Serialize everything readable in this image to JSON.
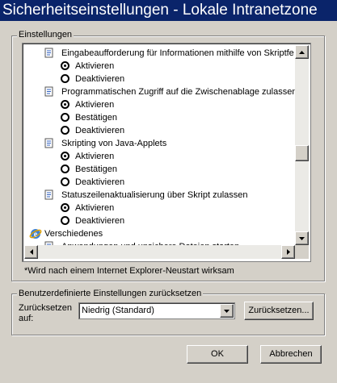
{
  "window": {
    "title": "Sicherheitseinstellungen - Lokale Intranetzone"
  },
  "settings_group": {
    "label": "Einstellungen"
  },
  "settings_list": [
    {
      "type": "setting",
      "label": "Eingabeaufforderung für Informationen mithilfe von Skriptfe"
    },
    {
      "type": "option",
      "label": "Aktivieren",
      "checked": true
    },
    {
      "type": "option",
      "label": "Deaktivieren",
      "checked": false
    },
    {
      "type": "setting",
      "label": "Programmatischen Zugriff auf die Zwischenablage zulassen"
    },
    {
      "type": "option",
      "label": "Aktivieren",
      "checked": true
    },
    {
      "type": "option",
      "label": "Bestätigen",
      "checked": false
    },
    {
      "type": "option",
      "label": "Deaktivieren",
      "checked": false
    },
    {
      "type": "setting",
      "label": "Skripting von Java-Applets"
    },
    {
      "type": "option",
      "label": "Aktivieren",
      "checked": true
    },
    {
      "type": "option",
      "label": "Bestätigen",
      "checked": false
    },
    {
      "type": "option",
      "label": "Deaktivieren",
      "checked": false
    },
    {
      "type": "setting",
      "label": "Statuszeilenaktualisierung über Skript zulassen"
    },
    {
      "type": "option",
      "label": "Aktivieren",
      "checked": true
    },
    {
      "type": "option",
      "label": "Deaktivieren",
      "checked": false
    },
    {
      "type": "category",
      "label": "Verschiedenes"
    },
    {
      "type": "setting",
      "label": "Anwendungen und unsichere Dateien starten"
    }
  ],
  "restart_note": "*Wird nach einem Internet Explorer-Neustart wirksam",
  "reset_group": {
    "label": "Benutzerdefinierte Einstellungen zurücksetzen",
    "reset_to_label_1": "Zurücksetzen",
    "reset_to_label_2": "auf:",
    "selected_level": "Niedrig (Standard)",
    "reset_button": "Zurücksetzen..."
  },
  "footer": {
    "ok": "OK",
    "cancel": "Abbrechen"
  },
  "icons": {
    "up": "scroll-up-arrow",
    "down": "scroll-down-arrow",
    "left": "scroll-left-arrow",
    "right": "scroll-right-arrow",
    "dropdown": "dropdown-arrow",
    "setting": "script-setting-icon",
    "category": "ie-globe-icon"
  },
  "scroll": {
    "vertical_position": 0.58,
    "horizontal_position": 0.0
  }
}
